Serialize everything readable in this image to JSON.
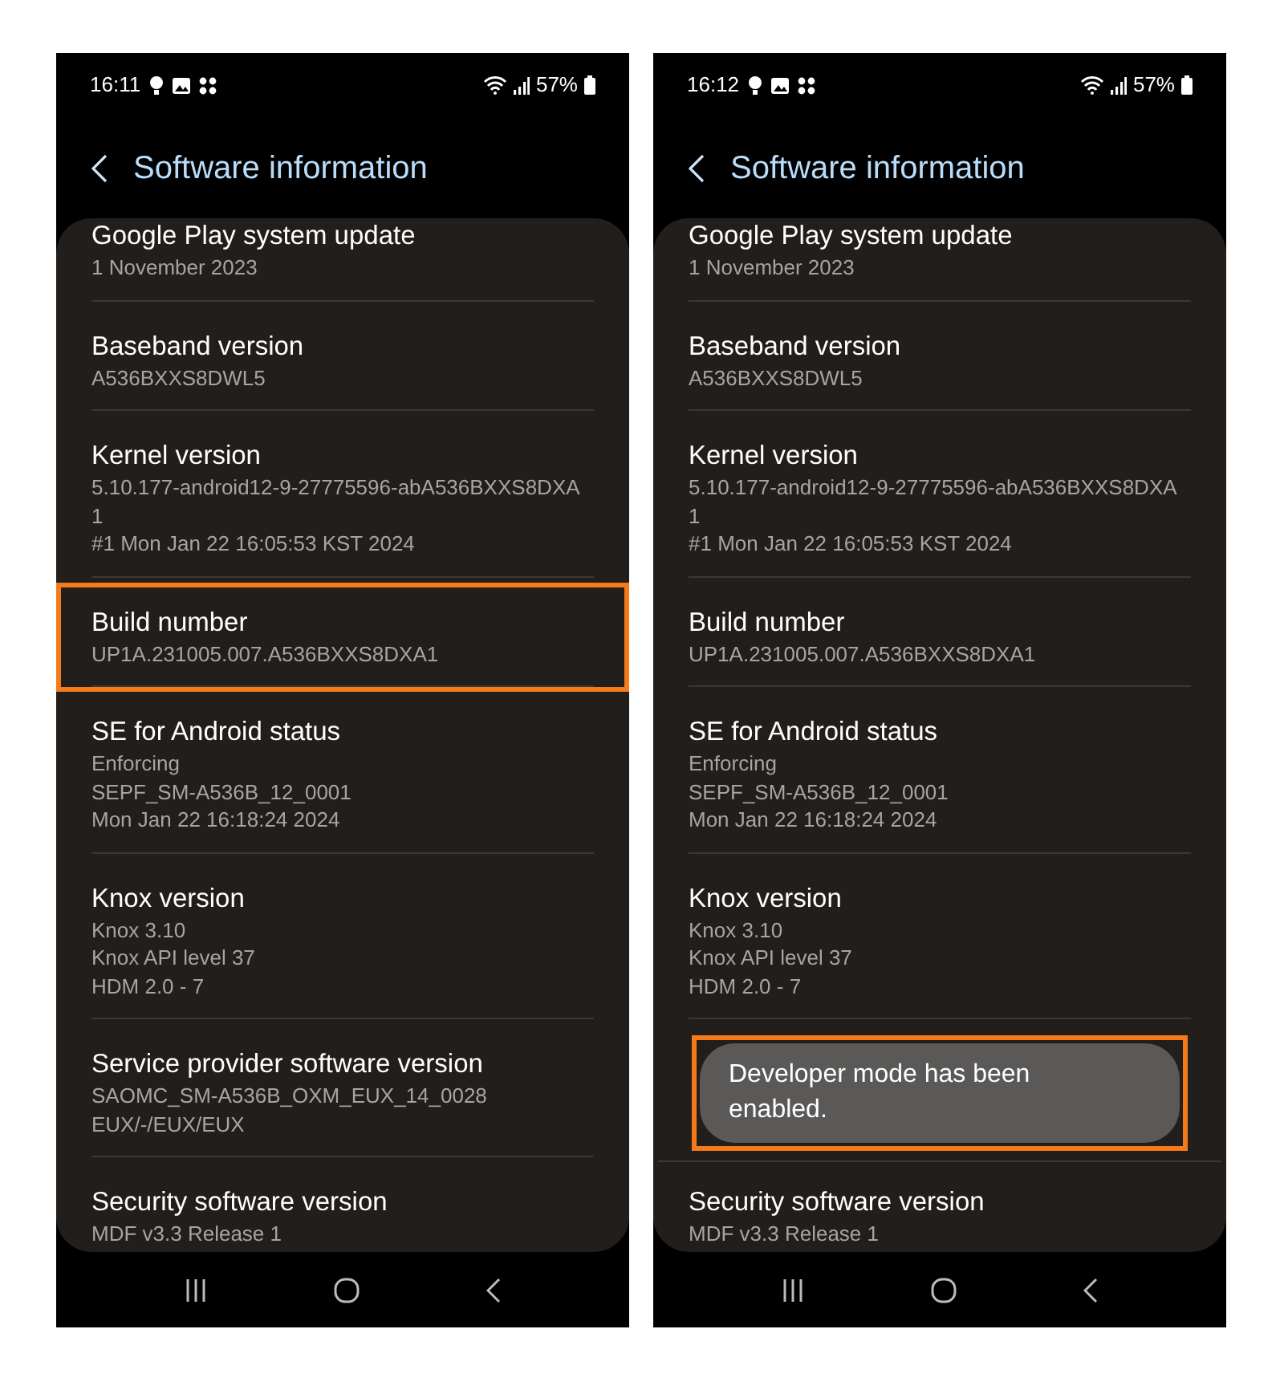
{
  "phones": [
    {
      "status_bar": {
        "time": "16:11",
        "battery": "57%"
      },
      "header": {
        "title": "Software information"
      },
      "rows": [
        {
          "kind": "info",
          "title": "Google Play system update",
          "lines": [
            "1 November 2023"
          ],
          "highlighted": false
        },
        {
          "kind": "info",
          "title": "Baseband version",
          "lines": [
            "A536BXXS8DWL5"
          ],
          "highlighted": false
        },
        {
          "kind": "info",
          "title": "Kernel version",
          "lines": [
            "5.10.177-android12-9-27775596-abA536BXXS8DXA",
            "1",
            "#1 Mon Jan 22 16:05:53 KST 2024"
          ],
          "highlighted": false
        },
        {
          "kind": "info",
          "title": "Build number",
          "lines": [
            "UP1A.231005.007.A536BXXS8DXA1"
          ],
          "highlighted": true
        },
        {
          "kind": "info",
          "title": "SE for Android status",
          "lines": [
            "Enforcing",
            "SEPF_SM-A536B_12_0001",
            "Mon Jan 22 16:18:24 2024"
          ],
          "highlighted": false
        },
        {
          "kind": "info",
          "title": "Knox version",
          "lines": [
            "Knox 3.10",
            "Knox API level 37",
            "HDM 2.0 - 7"
          ],
          "highlighted": false
        },
        {
          "kind": "info",
          "title": "Service provider software version",
          "lines": [
            "SAOMC_SM-A536B_OXM_EUX_14_0028",
            "EUX/-/EUX/EUX"
          ],
          "highlighted": false
        },
        {
          "kind": "info",
          "title": "Security software version",
          "lines": [
            "MDF v3.3 Release 1"
          ],
          "highlighted": false
        }
      ]
    },
    {
      "status_bar": {
        "time": "16:12",
        "battery": "57%"
      },
      "header": {
        "title": "Software information"
      },
      "rows": [
        {
          "kind": "info",
          "title": "Google Play system update",
          "lines": [
            "1 November 2023"
          ],
          "highlighted": false
        },
        {
          "kind": "info",
          "title": "Baseband version",
          "lines": [
            "A536BXXS8DWL5"
          ],
          "highlighted": false
        },
        {
          "kind": "info",
          "title": "Kernel version",
          "lines": [
            "5.10.177-android12-9-27775596-abA536BXXS8DXA",
            "1",
            "#1 Mon Jan 22 16:05:53 KST 2024"
          ],
          "highlighted": false
        },
        {
          "kind": "info",
          "title": "Build number",
          "lines": [
            "UP1A.231005.007.A536BXXS8DXA1"
          ],
          "highlighted": false
        },
        {
          "kind": "info",
          "title": "SE for Android status",
          "lines": [
            "Enforcing",
            "SEPF_SM-A536B_12_0001",
            "Mon Jan 22 16:18:24 2024"
          ],
          "highlighted": false
        },
        {
          "kind": "info",
          "title": "Knox version",
          "lines": [
            "Knox 3.10",
            "Knox API level 37",
            "HDM 2.0 - 7"
          ],
          "highlighted": false
        },
        {
          "kind": "toast",
          "text": "Developer mode has been enabled.",
          "highlighted": true
        },
        {
          "kind": "info",
          "title": "Security software version",
          "lines": [
            "MDF v3.3 Release 1"
          ],
          "highlighted": false
        }
      ]
    }
  ]
}
